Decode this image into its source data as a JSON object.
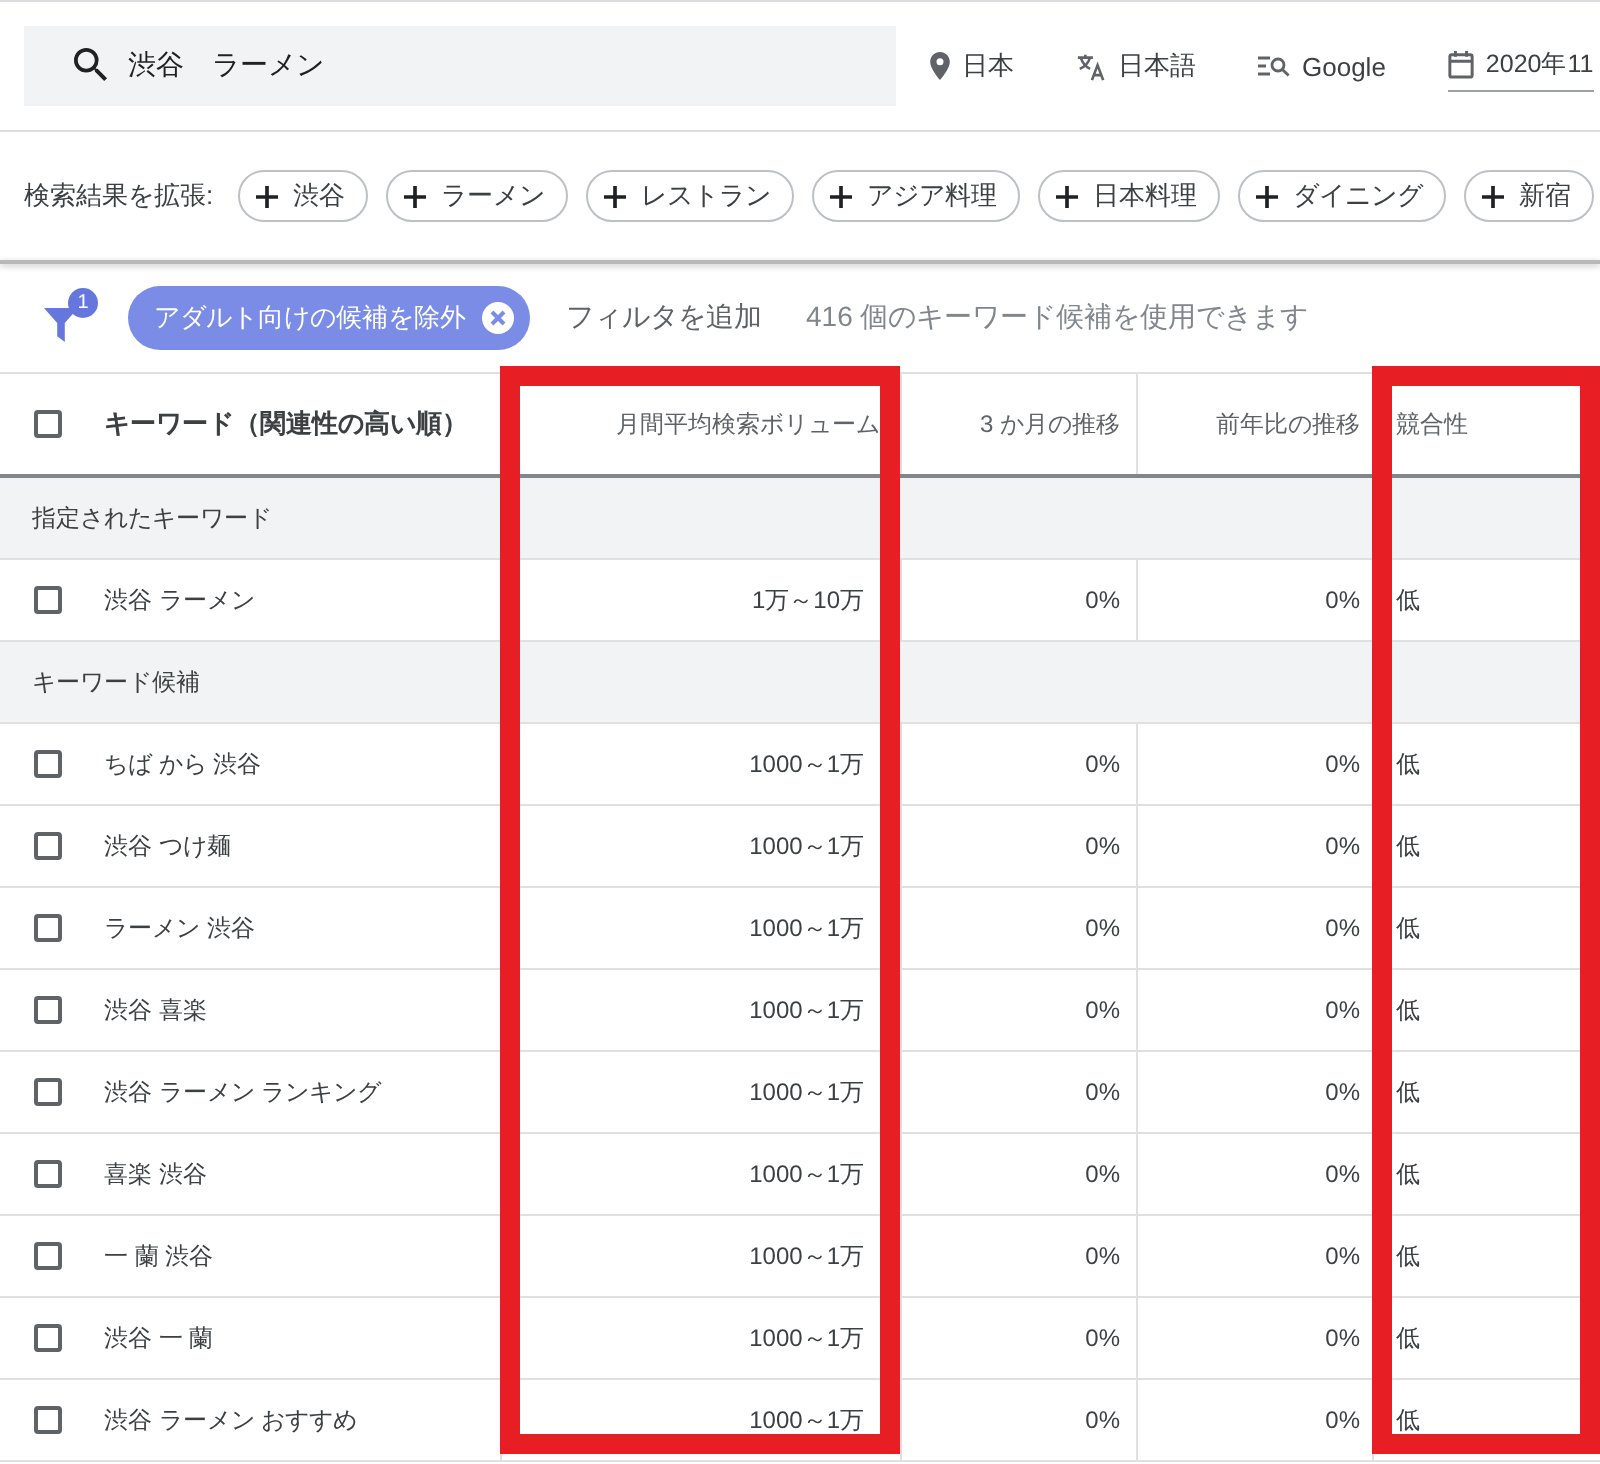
{
  "search_bar": {
    "query": "渋谷　ラーメン"
  },
  "settings": [
    {
      "kind": "location",
      "label": "日本"
    },
    {
      "kind": "language",
      "label": "日本語"
    },
    {
      "kind": "network",
      "label": "Google"
    },
    {
      "kind": "date",
      "label": "2020年11"
    }
  ],
  "refine": {
    "label": "検索結果を拡張:",
    "chips": [
      "渋谷",
      "ラーメン",
      "レストラン",
      "アジア料理",
      "日本料理",
      "ダイニング",
      "新宿"
    ]
  },
  "filters": {
    "count": "1",
    "chips": [
      {
        "label": "アダルト向けの候補を除外"
      }
    ],
    "add_filter": "フィルタを追加",
    "summary": "416 個のキーワード候補を使用できます"
  },
  "table": {
    "select_all_checked": false,
    "columns": [
      {
        "label": "キーワード（関連性の高い順）",
        "highlighted": false
      },
      {
        "label": "月間平均検索ボリューム",
        "highlighted": true
      },
      {
        "label": "3 か月の推移",
        "highlighted": false
      },
      {
        "label": "前年比の推移",
        "highlighted": false
      },
      {
        "label": "競合性",
        "highlighted": true
      }
    ],
    "rows": [
      {
        "kind": "section",
        "label": "指定されたキーワード"
      },
      {
        "kind": "keyword",
        "checked": false,
        "cells": [
          "渋谷 ラーメン",
          "1万～10万",
          "0%",
          "0%",
          "低"
        ]
      },
      {
        "kind": "section",
        "label": "キーワード候補"
      },
      {
        "kind": "keyword",
        "checked": false,
        "cells": [
          "ちば から 渋谷",
          "1000～1万",
          "0%",
          "0%",
          "低"
        ]
      },
      {
        "kind": "keyword",
        "checked": false,
        "cells": [
          "渋谷 つけ麺",
          "1000～1万",
          "0%",
          "0%",
          "低"
        ]
      },
      {
        "kind": "keyword",
        "checked": false,
        "cells": [
          "ラーメン 渋谷",
          "1000～1万",
          "0%",
          "0%",
          "低"
        ]
      },
      {
        "kind": "keyword",
        "checked": false,
        "cells": [
          "渋谷 喜楽",
          "1000～1万",
          "0%",
          "0%",
          "低"
        ]
      },
      {
        "kind": "keyword",
        "checked": false,
        "cells": [
          "渋谷 ラーメン ランキング",
          "1000～1万",
          "0%",
          "0%",
          "低"
        ]
      },
      {
        "kind": "keyword",
        "checked": false,
        "cells": [
          "喜楽 渋谷",
          "1000～1万",
          "0%",
          "0%",
          "低"
        ]
      },
      {
        "kind": "keyword",
        "checked": false,
        "cells": [
          "一 蘭 渋谷",
          "1000～1万",
          "0%",
          "0%",
          "低"
        ]
      },
      {
        "kind": "keyword",
        "checked": false,
        "cells": [
          "渋谷 一 蘭",
          "1000～1万",
          "0%",
          "0%",
          "低"
        ]
      },
      {
        "kind": "keyword",
        "checked": false,
        "cells": [
          "渋谷 ラーメン おすすめ",
          "1000～1万",
          "0%",
          "0%",
          "低"
        ]
      }
    ]
  }
}
